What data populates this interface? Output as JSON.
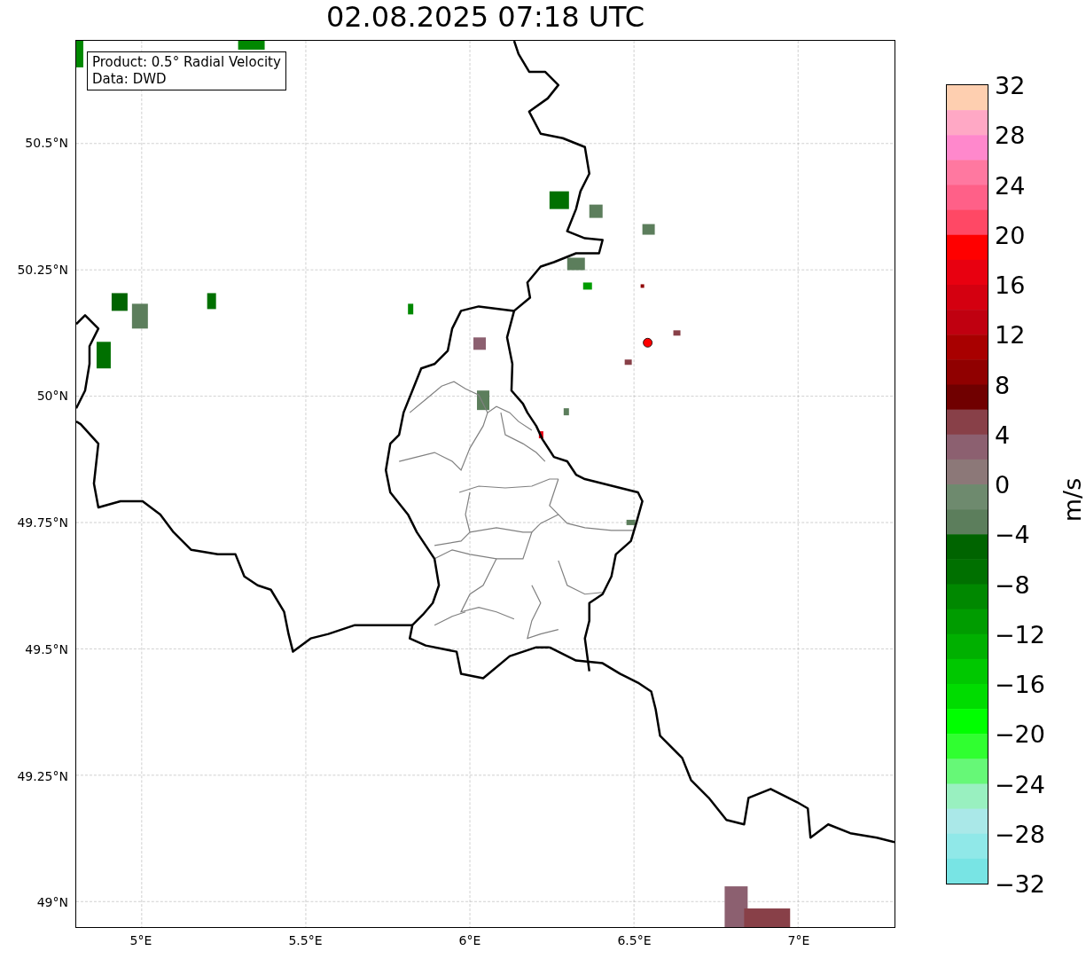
{
  "title": "02.08.2025 07:18 UTC",
  "map": {
    "legend": [
      "Product: 0.5° Radial Velocity",
      "Data: DWD"
    ],
    "lat_ticks": [
      "50.5°N",
      "50.25°N",
      "50°N",
      "49.75°N",
      "49.5°N",
      "49.25°N",
      "49°N"
    ],
    "lon_ticks": [
      "5°E",
      "5.5°E",
      "6°E",
      "6.5°E",
      "7°E"
    ]
  },
  "colorbar": {
    "label": "m/s",
    "ticks": [
      "32",
      "28",
      "24",
      "20",
      "16",
      "12",
      "8",
      "4",
      "0",
      "−4",
      "−8",
      "−12",
      "−16",
      "−20",
      "−24",
      "−28",
      "−32"
    ],
    "bins": [
      {
        "color": "#fecfb0"
      },
      {
        "color": "#ffa8c5"
      },
      {
        "color": "#ff88cc"
      },
      {
        "color": "#ff78a0"
      },
      {
        "color": "#ff6088"
      },
      {
        "color": "#ff4865"
      },
      {
        "color": "#ff0000"
      },
      {
        "color": "#e80010"
      },
      {
        "color": "#d40010"
      },
      {
        "color": "#c00010"
      },
      {
        "color": "#a80000"
      },
      {
        "color": "#900000"
      },
      {
        "color": "#700000"
      },
      {
        "color": "#884048"
      },
      {
        "color": "#8c6070"
      },
      {
        "color": "#8c7878"
      },
      {
        "color": "#6e8a6e"
      },
      {
        "color": "#5c7e5c"
      },
      {
        "color": "#006400"
      },
      {
        "color": "#007000"
      },
      {
        "color": "#008800"
      },
      {
        "color": "#009c00"
      },
      {
        "color": "#00b000"
      },
      {
        "color": "#00c800"
      },
      {
        "color": "#00dc00"
      },
      {
        "color": "#00ff00"
      },
      {
        "color": "#30ff30"
      },
      {
        "color": "#66f877"
      },
      {
        "color": "#99f0c0"
      },
      {
        "color": "#aae8e8"
      },
      {
        "color": "#90e8e8"
      },
      {
        "color": "#78e4e4"
      }
    ]
  }
}
